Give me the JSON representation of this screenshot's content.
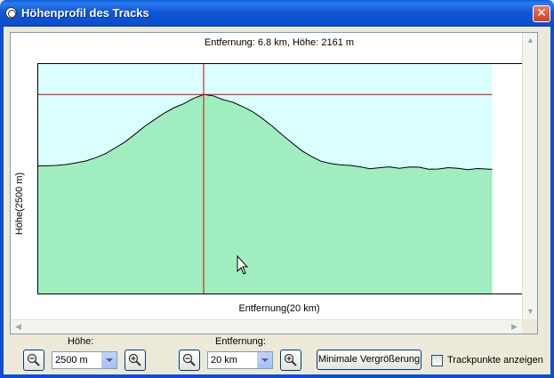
{
  "window": {
    "title": "Höhenprofil des Tracks",
    "close_symbol": "✕",
    "icon": "globe-icon"
  },
  "chart": {
    "readout": "Entfernung: 6.8 km, Höhe: 2161 m",
    "ylabel": "Höhe(2500 m)",
    "xlabel": "Entfernung(20 km)",
    "fill_color": "#a0eec0",
    "sky_color": "#d9ffff",
    "crosshair_color": "#cc0000"
  },
  "chart_data": {
    "type": "area",
    "x_unit": "km",
    "y_unit": "m",
    "xlim": [
      0,
      20
    ],
    "ylim": [
      0,
      2500
    ],
    "data_extent_x": 18.6,
    "cursor": {
      "x": 6.8,
      "y": 2161
    },
    "profile": [
      [
        0.0,
        1388
      ],
      [
        0.4,
        1390
      ],
      [
        0.8,
        1394
      ],
      [
        1.2,
        1405
      ],
      [
        1.6,
        1423
      ],
      [
        2.0,
        1443
      ],
      [
        2.4,
        1479
      ],
      [
        2.8,
        1523
      ],
      [
        3.2,
        1587
      ],
      [
        3.6,
        1651
      ],
      [
        4.0,
        1734
      ],
      [
        4.4,
        1818
      ],
      [
        4.8,
        1891
      ],
      [
        5.2,
        1962
      ],
      [
        5.6,
        2019
      ],
      [
        6.0,
        2063
      ],
      [
        6.4,
        2121
      ],
      [
        6.8,
        2161
      ],
      [
        7.2,
        2146
      ],
      [
        7.6,
        2105
      ],
      [
        8.0,
        2077
      ],
      [
        8.4,
        2030
      ],
      [
        8.8,
        1976
      ],
      [
        9.2,
        1902
      ],
      [
        9.6,
        1820
      ],
      [
        10.0,
        1728
      ],
      [
        10.4,
        1640
      ],
      [
        10.8,
        1556
      ],
      [
        11.2,
        1492
      ],
      [
        11.6,
        1439
      ],
      [
        12.0,
        1414
      ],
      [
        12.4,
        1400
      ],
      [
        12.8,
        1394
      ],
      [
        13.2,
        1380
      ],
      [
        13.6,
        1359
      ],
      [
        14.0,
        1370
      ],
      [
        14.4,
        1379
      ],
      [
        14.8,
        1363
      ],
      [
        15.2,
        1378
      ],
      [
        15.6,
        1376
      ],
      [
        16.0,
        1354
      ],
      [
        16.4,
        1356
      ],
      [
        16.8,
        1370
      ],
      [
        17.2,
        1363
      ],
      [
        17.6,
        1348
      ],
      [
        18.0,
        1361
      ],
      [
        18.6,
        1352
      ]
    ]
  },
  "toolbar": {
    "hoehe_label": "Höhe:",
    "hoehe_value": "2500 m",
    "entfernung_label": "Entfernung:",
    "entfernung_value": "20 km",
    "min_button": "Minimale Vergrößerung",
    "trackpoints_label": "Trackpunkte anzeigen",
    "trackpoints_checked": false
  }
}
